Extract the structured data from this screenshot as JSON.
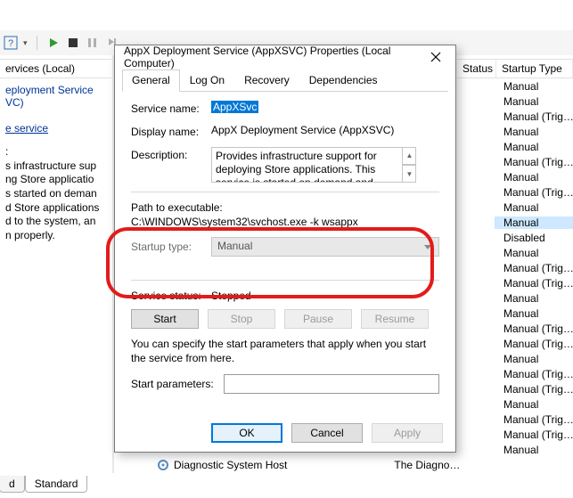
{
  "toolbar": {
    "help_icon": "help",
    "dropdown_icon": "▾",
    "play_icon": "▶",
    "stop_icon": "■",
    "pause_icon": "❚❚",
    "restart_icon": "↻"
  },
  "left": {
    "header": "ervices (Local)",
    "svc_name": "eployment Service VC)",
    "link1": "e service",
    "desc_label": ":",
    "desc_line1": "s infrastructure sup",
    "desc_line2": "ng Store applicatio",
    "desc_line3": "s started on deman",
    "desc_line4": "d Store applications",
    "desc_line5": "d to the system, an",
    "desc_line6": "n properly."
  },
  "tabs": {
    "extended": "d",
    "standard": "Standard"
  },
  "right": {
    "col_status": "Status",
    "col_startup": "Startup Type",
    "rows": [
      {
        "status": "",
        "startup": "Manual"
      },
      {
        "status": "",
        "startup": "Manual"
      },
      {
        "status": "",
        "startup": "Manual (Trig…"
      },
      {
        "status": "",
        "startup": "Manual"
      },
      {
        "status": "",
        "startup": "Manual"
      },
      {
        "status": "",
        "startup": "Manual (Trig…"
      },
      {
        "status": "",
        "startup": "Manual"
      },
      {
        "status": "",
        "startup": "Manual (Trig…"
      },
      {
        "status": "",
        "startup": "Manual"
      },
      {
        "status": "",
        "startup": "Manual",
        "selected": true
      },
      {
        "status": "",
        "startup": "Disabled"
      },
      {
        "status": "",
        "startup": "Manual"
      },
      {
        "status": "",
        "startup": "Manual (Trig…"
      },
      {
        "status": "",
        "startup": "Manual (Trig…"
      },
      {
        "status": "",
        "startup": "Manual"
      },
      {
        "status": "",
        "startup": "Manual"
      },
      {
        "status": "",
        "startup": "Manual (Trig…"
      },
      {
        "status": "",
        "startup": "Manual (Trig…"
      },
      {
        "status": "",
        "startup": "Manual"
      },
      {
        "status": "",
        "startup": "Manual (Trig…"
      },
      {
        "status": "",
        "startup": "Manual (Trig…"
      },
      {
        "status": "",
        "startup": "Manual"
      },
      {
        "status": "",
        "startup": "Manual (Trig…"
      },
      {
        "status": "",
        "startup": "Manual (Trig…"
      },
      {
        "status": "",
        "startup": "Manual"
      }
    ]
  },
  "bottom_row": {
    "name": "Diagnostic System Host",
    "desc": "The Diagno…"
  },
  "dialog": {
    "title": "AppX Deployment Service (AppXSVC) Properties (Local Computer)",
    "tabs": {
      "general": "General",
      "logon": "Log On",
      "recovery": "Recovery",
      "deps": "Dependencies"
    },
    "service_name_label": "Service name:",
    "service_name_value": "AppXSvc",
    "display_name_label": "Display name:",
    "display_name_value": "AppX Deployment Service (AppXSVC)",
    "description_label": "Description:",
    "description_value": "Provides infrastructure support for deploying Store applications. This service is started on demand and",
    "path_label": "Path to executable:",
    "path_value": "C:\\WINDOWS\\system32\\svchost.exe -k wsappx",
    "startup_label": "Startup type:",
    "startup_value": "Manual",
    "status_label": "Service status:",
    "status_value": "Stopped",
    "btn_start": "Start",
    "btn_stop": "Stop",
    "btn_pause": "Pause",
    "btn_resume": "Resume",
    "note": "You can specify the start parameters that apply when you start the service from here.",
    "start_params_label": "Start parameters:",
    "start_params_value": "",
    "ok": "OK",
    "cancel": "Cancel",
    "apply": "Apply"
  }
}
